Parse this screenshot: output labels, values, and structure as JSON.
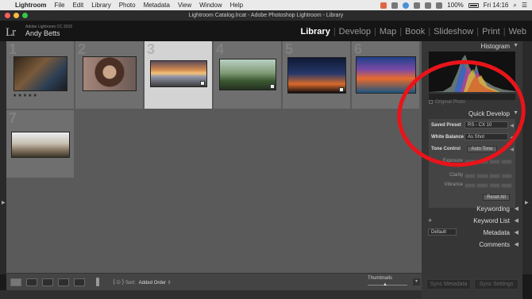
{
  "menubar": {
    "items": [
      "Lightroom",
      "File",
      "Edit",
      "Library",
      "Photo",
      "Metadata",
      "View",
      "Window",
      "Help"
    ],
    "battery": "100%",
    "clock": "Fri 14:16"
  },
  "window": {
    "title": "Lightroom Catalog.lrcat - Adobe Photoshop Lightroom - Library"
  },
  "identity": {
    "logo": "Lr",
    "app_name": "Adobe Lightroom CC 2015",
    "user": "Andy Betts"
  },
  "modules": [
    "Library",
    "Develop",
    "Map",
    "Book",
    "Slideshow",
    "Print",
    "Web"
  ],
  "active_module": "Library",
  "grid": {
    "cells": [
      {
        "num": "1",
        "stars": "★★★★★"
      },
      {
        "num": "2"
      },
      {
        "num": "3",
        "selected": true
      },
      {
        "num": "4"
      },
      {
        "num": "5"
      },
      {
        "num": "6"
      },
      {
        "num": "7"
      }
    ]
  },
  "toolbar": {
    "sort_label": "Sort:",
    "sort_value": "Added Order",
    "thumbnails_label": "Thumbnails"
  },
  "right_panel": {
    "histogram": "Histogram",
    "original_photo": "Original Photo",
    "quick_develop": {
      "title": "Quick Develop",
      "saved_preset_label": "Saved Preset",
      "saved_preset_value": "RS - CX 10",
      "white_balance_label": "White Balance",
      "white_balance_value": "As Shot",
      "tone_control_label": "Tone Control",
      "auto_tone": "Auto Tone",
      "exposure": "Exposure",
      "clarity": "Clarity",
      "vibrance": "Vibrance",
      "reset_all": "Reset All"
    },
    "keywording": "Keywording",
    "keyword_list": "Keyword List",
    "metadata": "Metadata",
    "metadata_preset": "Default",
    "comments": "Comments",
    "sync_metadata": "Sync Metadata",
    "sync_settings": "Sync Settings"
  },
  "colors": {
    "annotation_circle": "#e8141a",
    "grid_bg": "#5a5a5a",
    "selected_cell": "#d3d3d3"
  }
}
